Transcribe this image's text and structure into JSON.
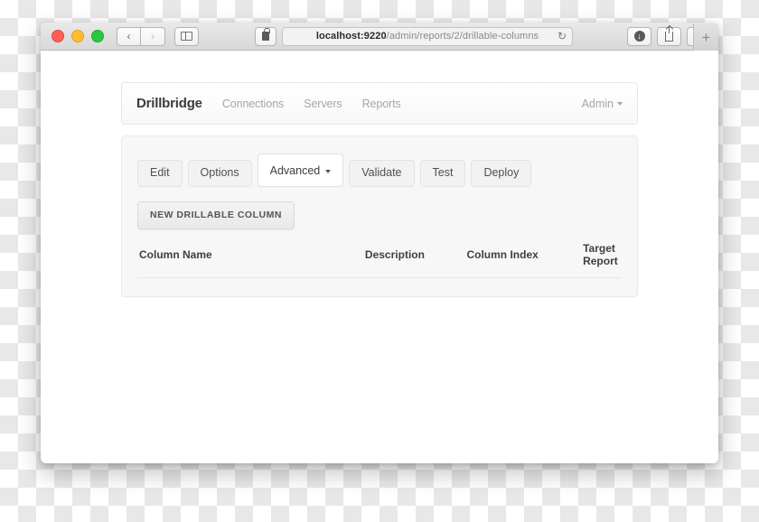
{
  "browser": {
    "traffic_lights": [
      "close",
      "minimize",
      "maximize"
    ],
    "back_label": "‹",
    "forward_label": "›",
    "sidebar_icon": "sidebar-icon",
    "lock_icon": "lock-icon",
    "url_host": "localhost:9220",
    "url_path": "/admin/reports/2/drillable-columns",
    "reload_label": "↻",
    "download_label": "↓",
    "share_icon": "share-icon",
    "tabs_icon": "tab-overview-icon",
    "new_tab_label": "+"
  },
  "navbar": {
    "brand": "Drillbridge",
    "links": [
      {
        "label": "Connections"
      },
      {
        "label": "Servers"
      },
      {
        "label": "Reports"
      }
    ],
    "account": "Admin"
  },
  "tabs": [
    {
      "label": "Edit",
      "active": false
    },
    {
      "label": "Options",
      "active": false
    },
    {
      "label": "Advanced",
      "active": true,
      "has_caret": true
    },
    {
      "label": "Validate",
      "active": false
    },
    {
      "label": "Test",
      "active": false
    },
    {
      "label": "Deploy",
      "active": false
    }
  ],
  "actions": {
    "new_column": "NEW DRILLABLE COLUMN"
  },
  "table": {
    "headers": [
      "Column Name",
      "Description",
      "Column Index",
      "Target Report"
    ],
    "rows": []
  },
  "colors": {
    "panel_bg": "#f7f7f7",
    "page_bg": "#ffffff",
    "nav_link": "#a6a6a6",
    "brand_text": "#3b3b3b",
    "traffic_red": "#ff5f57",
    "traffic_yellow": "#ffbd2e",
    "traffic_green": "#28c840"
  }
}
